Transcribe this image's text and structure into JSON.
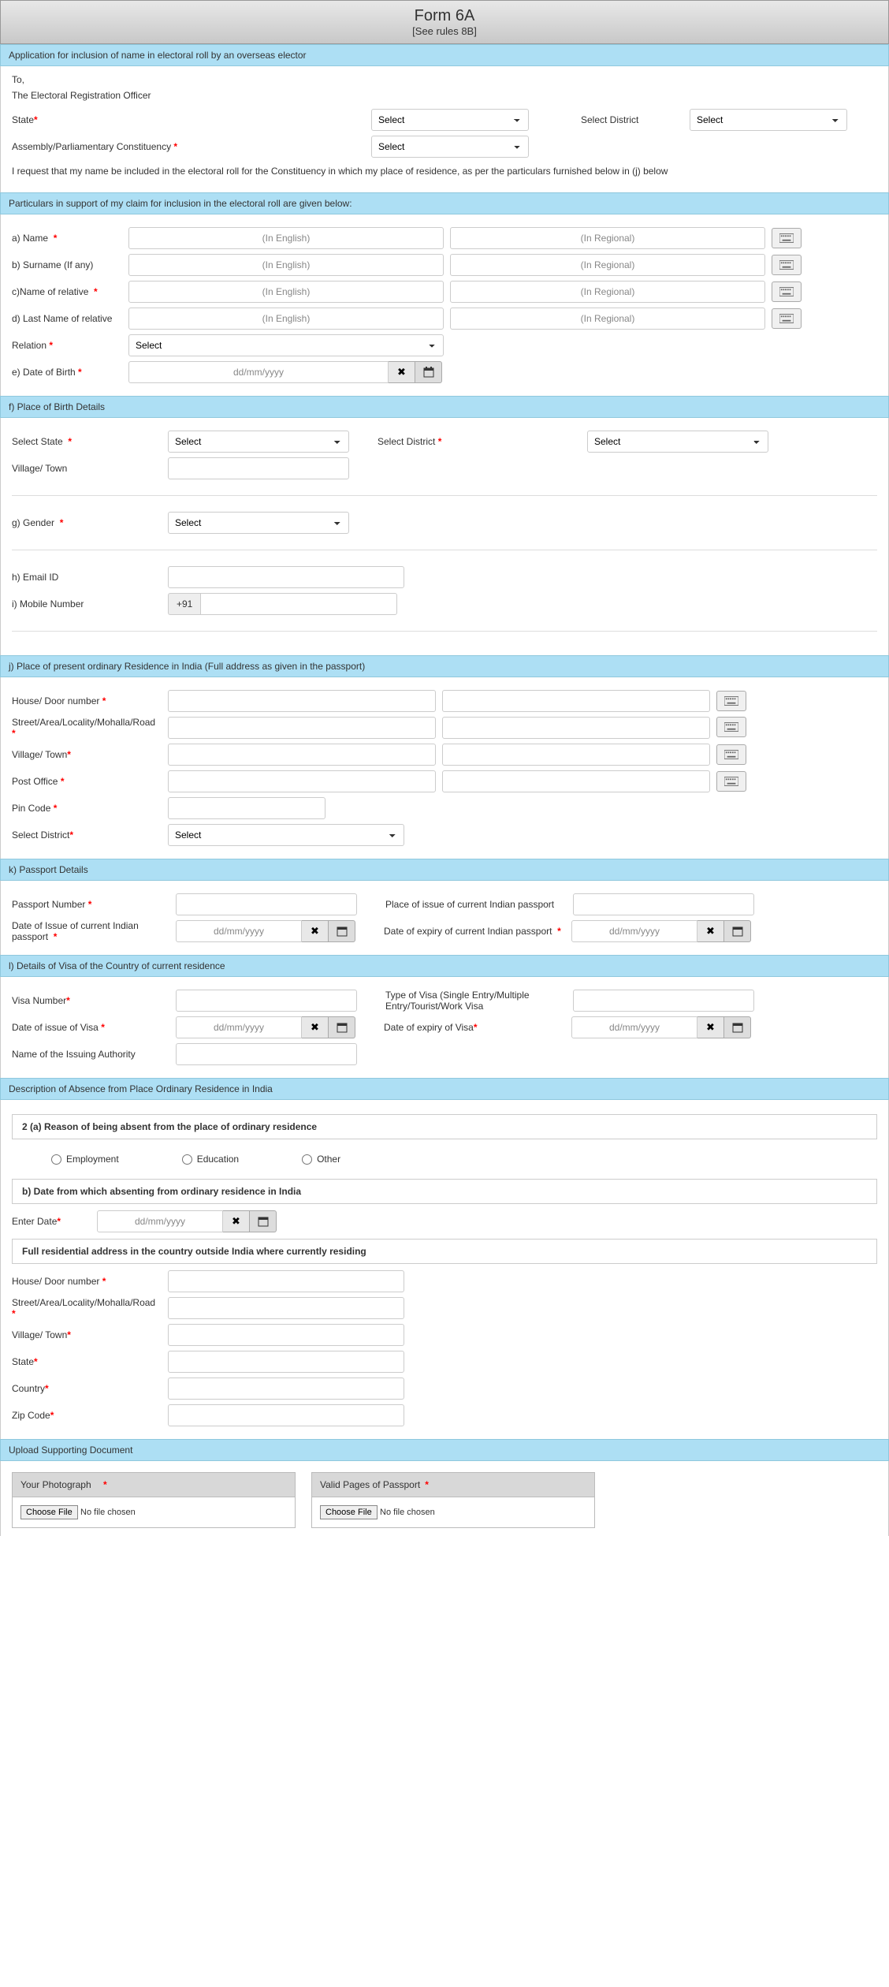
{
  "header": {
    "title": "Form 6A",
    "subtitle": "[See rules 8B]"
  },
  "section_app": "Application for inclusion of name in electoral roll by an overseas elector",
  "to_line1": "To,",
  "to_line2": "The Electoral Registration Officer",
  "state_label": "State",
  "district_top_label": "Select District",
  "assembly_label": "Assembly/Parliamentary Constituency",
  "request_para": "I request that my name be included in the electoral roll for the Constituency in which my place of residence, as per the particulars furnished below in (j) below",
  "section_particulars": "Particulars in support of my claim for inclusion in the electoral roll are given below:",
  "a_name": "a) Name",
  "b_surname": "b) Surname (If any)",
  "c_relname": "c)Name of relative",
  "d_rellast": "d) Last Name of relative",
  "relation": "Relation",
  "e_dob": "e) Date of Birth",
  "ph_en": "(In English)",
  "ph_re": "(In Regional)",
  "ph_date": "dd/mm/yyyy",
  "select_opt": "Select",
  "section_f": "f) Place of Birth Details",
  "sel_state": "Select State",
  "sel_district": "Select District",
  "village_town": "Village/ Town",
  "g_gender": "g) Gender",
  "h_email": "h) Email ID",
  "i_mobile": "i) Mobile Number",
  "mobile_prefix": "+91",
  "section_j": "j) Place of present ordinary Residence in India (Full address as given in the passport)",
  "house": "House/ Door number",
  "street": "Street/Area/Locality/Mohalla/Road",
  "post_office": "Post Office",
  "pincode": "Pin Code",
  "section_k": "k) Passport Details",
  "passport_no": "Passport Number",
  "passport_place": "Place of issue of current Indian passport",
  "passport_issue": "Date of Issue of current Indian passport",
  "passport_expiry": "Date of expiry of current Indian passport",
  "section_l": "l) Details of Visa of the Country of current residence",
  "visa_no": "Visa Number",
  "visa_type": "Type of Visa (Single Entry/Multiple Entry/Tourist/Work Visa",
  "visa_issue": "Date of issue of Visa",
  "visa_expiry": "Date of expiry of Visa",
  "issuing_auth": "Name of the Issuing Authority",
  "section_absence": "Description of Absence from Place Ordinary Residence in India",
  "q2a": "2 (a) Reason of being absent from the place of ordinary residence",
  "opt_emp": "Employment",
  "opt_edu": "Education",
  "opt_oth": "Other",
  "q2b": "b) Date from which absenting from ordinary residence in India",
  "enter_date": "Enter Date",
  "q_full_addr": "Full residential address in the country outside India where currently residing",
  "state_l": "State",
  "country": "Country",
  "zip": "Zip Code",
  "section_upload": "Upload Supporting Document",
  "photo": "Your Photograph",
  "passport_pages": "Valid Pages of Passport",
  "choose_file": "Choose File",
  "no_file": "No file chosen",
  "clear_sym": "✖",
  "cal_sym": "📅"
}
